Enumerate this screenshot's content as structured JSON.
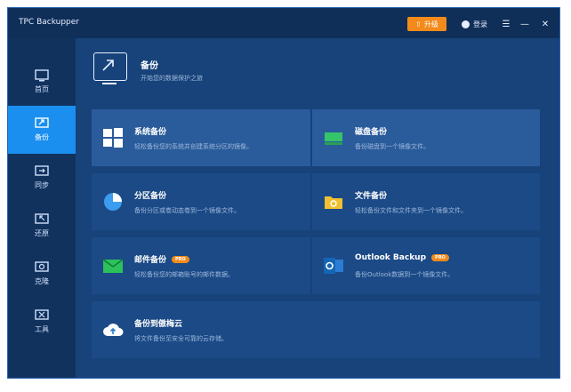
{
  "app": {
    "title": "TPC Backupper",
    "upgrade_label": "升级",
    "login_label": "登录"
  },
  "sidebar": {
    "items": [
      {
        "label": "首页"
      },
      {
        "label": "备份"
      },
      {
        "label": "同步"
      },
      {
        "label": "还原"
      },
      {
        "label": "克隆"
      },
      {
        "label": "工具"
      }
    ]
  },
  "header": {
    "title": "备份",
    "subtitle": "开始您的数据保护之旅"
  },
  "cards": [
    {
      "title": "系统备份",
      "desc": "轻松备份您的系统并创建系统分区的镜像。",
      "badge": ""
    },
    {
      "title": "磁盘备份",
      "desc": "备份磁盘到一个镜像文件。",
      "badge": ""
    },
    {
      "title": "分区备份",
      "desc": "备份分区或卷动态卷到一个镜像文件。",
      "badge": ""
    },
    {
      "title": "文件备份",
      "desc": "轻松备份文件和文件夹到一个镜像文件。",
      "badge": ""
    },
    {
      "title": "邮件备份",
      "desc": "轻松备份您的邮箱账号的邮件数据。",
      "badge": "PRO"
    },
    {
      "title": "Outlook Backup",
      "desc": "备份Outlook数据到一个镜像文件。",
      "badge": "PRO"
    },
    {
      "title": "备份到傲梅云",
      "desc": "将文件备份至安全可靠的云存储。",
      "badge": ""
    }
  ],
  "colors": {
    "accent": "#1a8ff0",
    "upgrade": "#f38a1b",
    "background": "#17427a"
  }
}
